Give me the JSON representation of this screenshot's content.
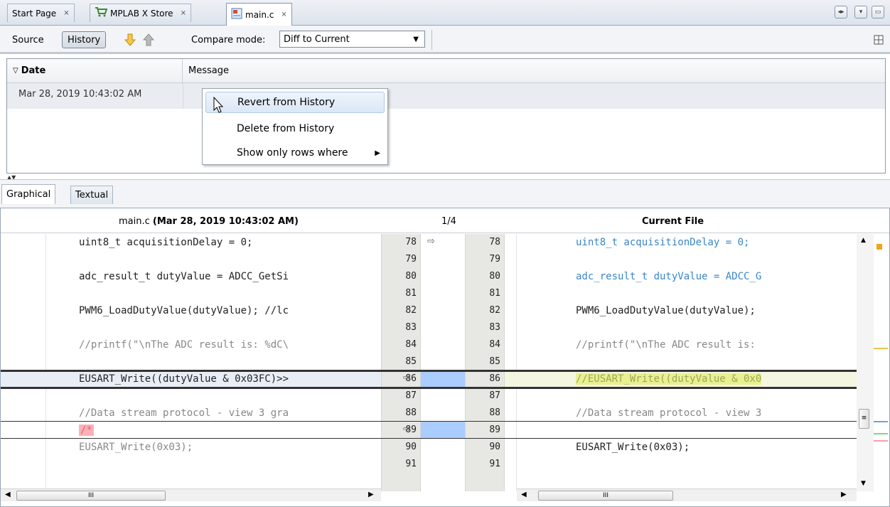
{
  "tabs": [
    {
      "label": "Start Page"
    },
    {
      "label": "MPLAB X Store"
    },
    {
      "label": "main.c"
    }
  ],
  "toolbar": {
    "source_label": "Source",
    "history_label": "History",
    "compare_mode_label": "Compare mode:",
    "compare_mode_value": "Diff to Current"
  },
  "history_table": {
    "columns": [
      "Date",
      "Message"
    ],
    "rows": [
      {
        "date": "Mar 28, 2019 10:43:02 AM",
        "message": ""
      }
    ]
  },
  "context_menu": {
    "items": [
      "Revert from History",
      "Delete from History",
      "Show only rows where"
    ]
  },
  "diff_tabs": [
    "Graphical",
    "Textual"
  ],
  "diff": {
    "left_header_file": "main.c",
    "left_header_date": "(Mar 28, 2019 10:43:02 AM)",
    "counter": "1/4",
    "right_header": "Current File",
    "left_lines": [
      "uint8_t acquisitionDelay = 0;",
      "",
      "adc_result_t dutyValue = ADCC_GetSi",
      "",
      "PWM6_LoadDutyValue(dutyValue); //lc",
      "",
      "//printf(\"\\nThe ADC result is: %dC\\",
      "",
      "EUSART_Write((dutyValue & 0x03FC)>>",
      "",
      "//Data stream protocol - view 3 gra",
      "/*",
      "EUSART_Write(0x03);",
      ""
    ],
    "right_lines": [
      "uint8_t acquisitionDelay = 0;",
      "",
      "adc_result_t dutyValue = ADCC_G",
      "",
      "PWM6_LoadDutyValue(dutyValue);",
      "",
      "//printf(\"\\nThe ADC result is:",
      "",
      "//EUSART_Write((dutyValue & 0x0",
      "",
      "//Data stream protocol - view 3",
      "",
      "EUSART_Write(0x03);",
      ""
    ],
    "line_numbers": [
      "78",
      "79",
      "80",
      "81",
      "82",
      "83",
      "84",
      "85",
      "86",
      "87",
      "88",
      "89",
      "90",
      "91"
    ],
    "scrollbar_mark": "III"
  },
  "colors": {
    "accent_selection": "#dbe7f7",
    "change_highlight": "#aaccff",
    "deleted_highlight": "#ffb0b8",
    "added_highlight": "#e9f08f",
    "keyword_blue": "#3b86c8"
  }
}
